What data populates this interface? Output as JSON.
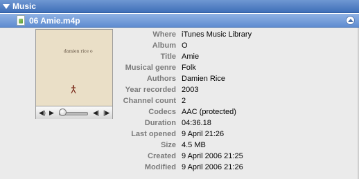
{
  "section": {
    "title": "Music"
  },
  "file": {
    "name": "06 Amie.m4p"
  },
  "artwork": {
    "text": "damien rice o"
  },
  "properties": [
    {
      "label": "Where",
      "value": "iTunes Music Library"
    },
    {
      "label": "Album",
      "value": "O"
    },
    {
      "label": "Title",
      "value": "Amie"
    },
    {
      "label": "Musical genre",
      "value": "Folk"
    },
    {
      "label": "Authors",
      "value": "Damien Rice"
    },
    {
      "label": "Year recorded",
      "value": "2003"
    },
    {
      "label": "Channel count",
      "value": "2"
    },
    {
      "label": "Codecs",
      "value": "AAC (protected)"
    },
    {
      "label": "Duration",
      "value": "04:36.18"
    },
    {
      "label": "Last opened",
      "value": "9 April 21:26"
    },
    {
      "label": "Size",
      "value": "4.5 MB"
    },
    {
      "label": "Created",
      "value": "9 April 2006 21:25"
    },
    {
      "label": "Modified",
      "value": "9 April 2006 21:26"
    }
  ],
  "player": {
    "position": 0.0
  },
  "colors": {
    "header": "#3f6fb8",
    "subheader": "#6f97d2",
    "label": "#7a7a7a"
  }
}
